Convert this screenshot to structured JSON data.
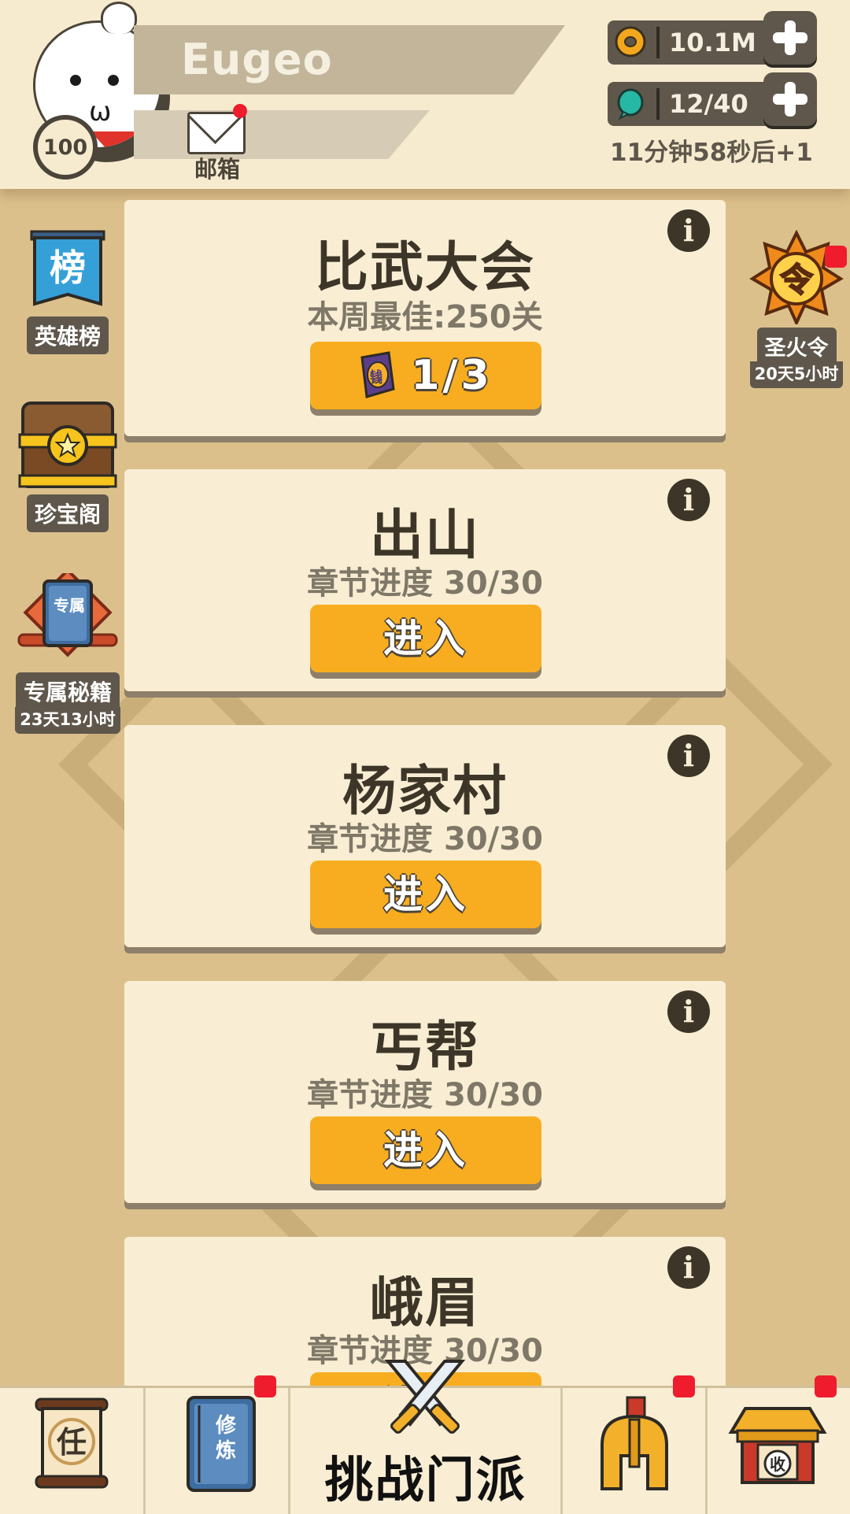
{
  "header": {
    "player_name": "Eugeo",
    "level": "100",
    "mail_label": "邮箱",
    "gold": "10.1M",
    "energy": "12/40",
    "energy_regen": "11分钟58秒后+1"
  },
  "side_left": [
    {
      "label": "英雄榜",
      "icon_text": "榜"
    },
    {
      "label": "珍宝阁"
    },
    {
      "label": "专属秘籍",
      "sub": "23天13小时",
      "icon_text": "专属"
    }
  ],
  "side_right": {
    "label": "圣火令",
    "sub": "20天5小时",
    "icon_text": "令"
  },
  "cards": [
    {
      "title": "比武大会",
      "subtitle": "本周最佳:250关",
      "button": "1/3",
      "ticket_icon_text": "钱"
    },
    {
      "title": "出山",
      "subtitle": "章节进度 30/30",
      "button": "进入"
    },
    {
      "title": "杨家村",
      "subtitle": "章节进度 30/30",
      "button": "进入"
    },
    {
      "title": "丐帮",
      "subtitle": "章节进度 30/30",
      "button": "进入"
    },
    {
      "title": "峨眉",
      "subtitle": "章节进度 30/30",
      "button": "进入"
    }
  ],
  "info_glyph": "i",
  "bottom_nav": {
    "tasks_icon_text": "任",
    "training_icon_text": "修炼",
    "challenge_label": "挑战门派",
    "collect_icon_text": "收"
  },
  "colors": {
    "background": "#dcc08c",
    "card": "#f9eed4",
    "button": "#f8ad20",
    "badge_red": "#ef1c2e",
    "dark": "#5f574b"
  }
}
